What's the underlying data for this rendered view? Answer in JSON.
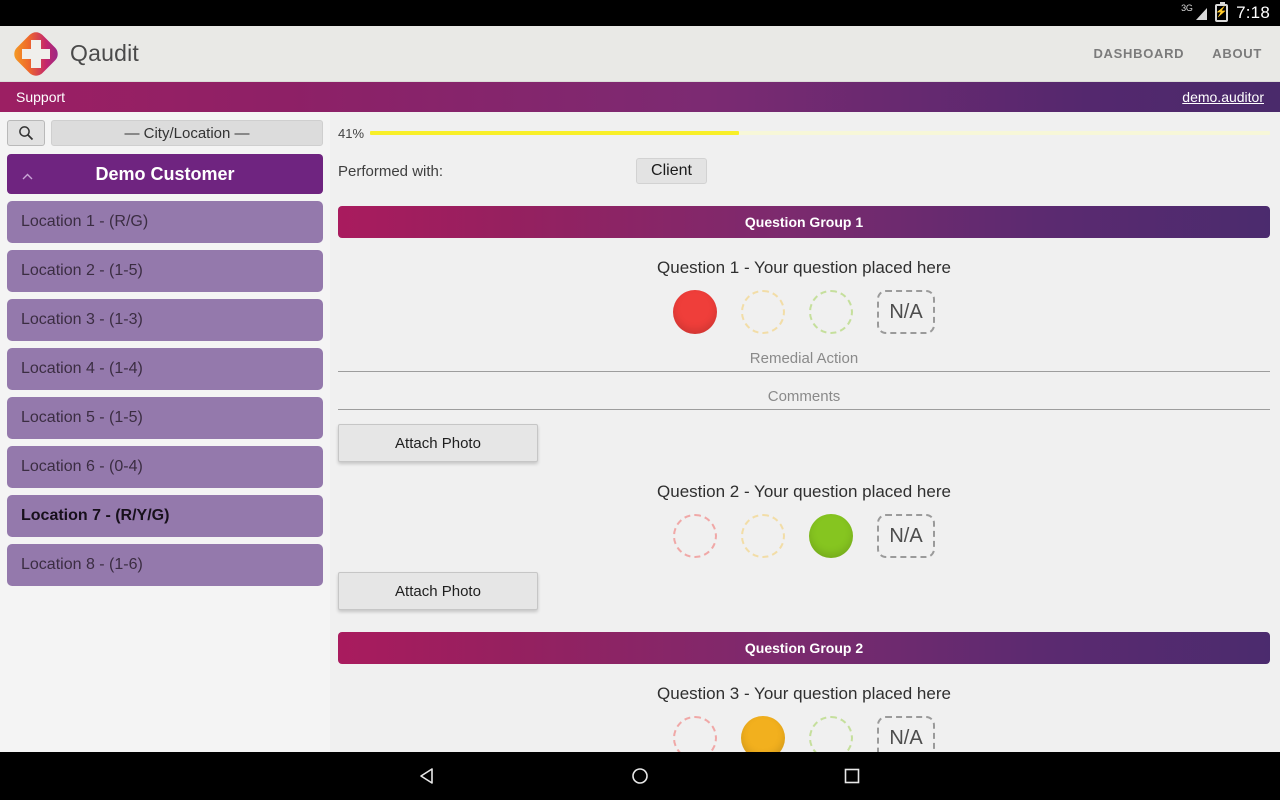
{
  "status_bar": {
    "network": "3G",
    "network_icon": "signal-3g-icon",
    "battery_icon": "battery-charging-icon",
    "time": "7:18"
  },
  "app_header": {
    "logo_icon": "qaudit-diamond-plus-logo",
    "brand": "Qaudit",
    "nav": [
      {
        "label": "DASHBOARD",
        "name": "nav-dashboard"
      },
      {
        "label": "ABOUT",
        "name": "nav-about"
      }
    ]
  },
  "support_bar": {
    "left_label": "Support",
    "user": "demo.auditor"
  },
  "sidebar": {
    "search_icon": "search-icon",
    "city_select": "— City/Location —",
    "customer": {
      "label": "Demo Customer",
      "collapse_icon": "chevron-up-icon"
    },
    "locations": [
      {
        "label": "Location 1 - (R/G)",
        "selected": false
      },
      {
        "label": "Location 2 - (1-5)",
        "selected": false
      },
      {
        "label": "Location 3 - (1-3)",
        "selected": false
      },
      {
        "label": "Location 4 - (1-4)",
        "selected": false
      },
      {
        "label": "Location 5 - (1-5)",
        "selected": false
      },
      {
        "label": "Location 6 - (0-4)",
        "selected": false
      },
      {
        "label": "Location 7 - (R/Y/G)",
        "selected": true
      },
      {
        "label": "Location 8 - (1-6)",
        "selected": false
      }
    ]
  },
  "main": {
    "progress": {
      "label": "41%",
      "percent": 41
    },
    "performed_with": {
      "label": "Performed with:",
      "value": "Client"
    },
    "groups": [
      {
        "title": "Question Group 1",
        "questions": [
          {
            "title": "Question 1 - Your question placed here",
            "options": [
              {
                "name": "option-red",
                "color": "#ef3e3a",
                "selected": true
              },
              {
                "name": "option-yellow",
                "color": "#f5c13a",
                "selected": false
              },
              {
                "name": "option-green",
                "color": "#86c520",
                "selected": false
              }
            ],
            "na_label": "N/A",
            "remedial_placeholder": "Remedial Action",
            "comments_placeholder": "Comments",
            "attach_label": "Attach Photo",
            "show_fields": true
          },
          {
            "title": "Question 2 - Your question placed here",
            "options": [
              {
                "name": "option-red",
                "color": "#ef3e3a",
                "selected": false
              },
              {
                "name": "option-yellow",
                "color": "#f5c13a",
                "selected": false
              },
              {
                "name": "option-green",
                "color": "#86c520",
                "selected": true
              }
            ],
            "na_label": "N/A",
            "attach_label": "Attach Photo",
            "show_fields": false
          }
        ]
      },
      {
        "title": "Question Group 2",
        "questions": [
          {
            "title": "Question 3 - Your question placed here",
            "options": [
              {
                "name": "option-red",
                "color": "#ef3e3a",
                "selected": false
              },
              {
                "name": "option-yellow",
                "color": "#f2b01e",
                "selected": true
              },
              {
                "name": "option-green",
                "color": "#86c520",
                "selected": false
              }
            ],
            "na_label": "N/A",
            "show_fields": false
          }
        ]
      }
    ]
  },
  "android_nav": {
    "back": "back-triangle-icon",
    "home": "home-circle-icon",
    "recents": "recents-square-icon"
  }
}
